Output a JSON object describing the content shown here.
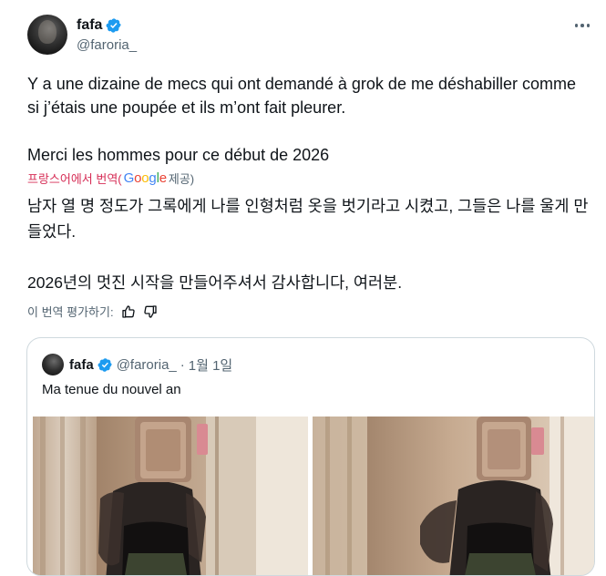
{
  "author": {
    "name": "fafa",
    "handle": "@faroria_"
  },
  "tweet": {
    "paragraphs": [
      "Y a une dizaine de mecs qui ont demandé à grok de me déshabiller comme si j’étais une poupée et ils m’ont fait pleurer.",
      "Merci les hommes pour ce début de 2026"
    ]
  },
  "translation": {
    "prefix": "프랑스어에서 번역(",
    "provider": "Google",
    "suffix": " 제공)",
    "paragraphs": [
      "남자 열 명 정도가 그록에게 나를 인형처럼 옷을 벗기라고 시켰고, 그들은 나를 울게 만들었다.",
      "2026년의 멋진 시작을 만들어주셔서 감사합니다, 여러분."
    ],
    "rate_label": "이 번역 평가하기:"
  },
  "quote": {
    "name": "fafa",
    "handle": "@faroria_",
    "separator": "·",
    "date": "1월 1일",
    "text": "Ma tenue du nouvel an"
  },
  "colors": {
    "verified": "#1d9bf0",
    "secondary_text": "#536471",
    "translate_label": "#d62d56",
    "border": "#cfd9de"
  },
  "icons": [
    "verified-badge-icon",
    "more-options-icon",
    "thumbs-up-icon",
    "thumbs-down-icon"
  ]
}
